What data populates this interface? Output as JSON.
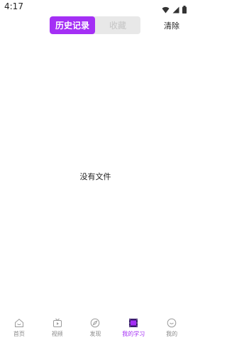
{
  "status_bar": {
    "time": "4:17"
  },
  "header": {
    "tabs": [
      {
        "label": "历史记录",
        "active": true
      },
      {
        "label": "收藏",
        "active": false
      }
    ],
    "clear_label": "清除"
  },
  "main": {
    "empty_message": "没有文件"
  },
  "tab_bar": {
    "items": [
      {
        "label": "首页",
        "icon": "home-icon",
        "active": false
      },
      {
        "label": "视频",
        "icon": "tv-icon",
        "active": false
      },
      {
        "label": "发现",
        "icon": "compass-icon",
        "active": false
      },
      {
        "label": "我的学习",
        "icon": "film-icon",
        "active": true
      },
      {
        "label": "我的",
        "icon": "profile-icon",
        "active": false
      }
    ]
  },
  "colors": {
    "accent": "#a42ff5",
    "inactive_tab_text": "#c4c4c4",
    "tab_label": "#8a8a8a"
  }
}
